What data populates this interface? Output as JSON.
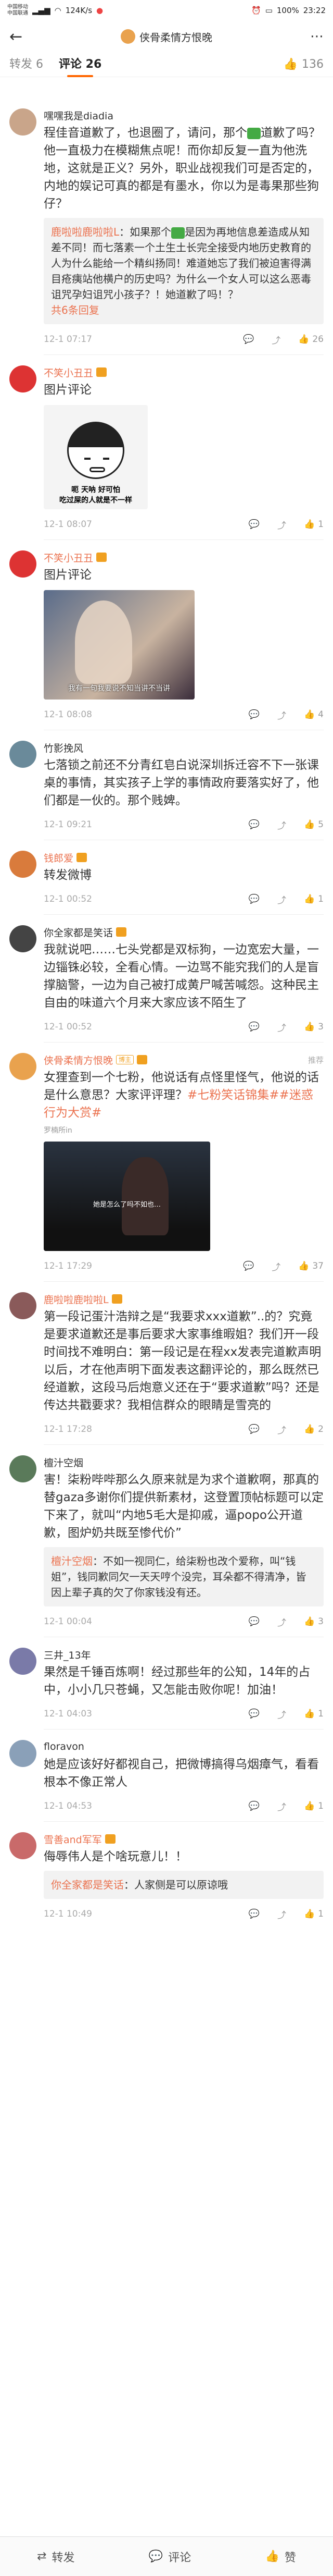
{
  "status": {
    "carrier1": "中国移动",
    "carrier2": "中国联通",
    "speed": "124K/s",
    "battery": "100%",
    "time": "23:22"
  },
  "header": {
    "title": "侠骨柔情方恨晚"
  },
  "tabs": {
    "repost": "转发 6",
    "comment": "评论 26",
    "like": "136"
  },
  "comments": [
    {
      "name": "嘿嘿我是diadia",
      "text": "程佳音道歉了，也退圈了，请问，那个",
      "text2": "道歉了吗？他一直极力在模糊焦点呢！而你却反复一直为他洗地，这就是正义？另外，职业战视我们可是否定的，内地的娱记可真的都是有墨水，你以为是毒果那些狗仔？",
      "reply_name": "鹿啦啦鹿啦啦L",
      "reply_text": "：如果那个",
      "reply_text2": "是因为再地信息差造成从知差不同！而七落素一个土生土长完全接受内地历史教育的人为什么能给一个精纠扬同！难道她忘了我们被迫害得满目疮痍站他横户的历史吗？为什么一个女人可以这么恶毒诅咒孕妇诅咒小孩子？！她道歉了吗！？",
      "reply_more": "共6条回复",
      "time": "12-1 07:17",
      "likes": "26"
    },
    {
      "name": "不笑小丑丑",
      "text": "图片评论",
      "meme1": "呃 天呐 好可怕",
      "meme2": "吃过屎的人就是不一样",
      "time": "12-1 08:07",
      "likes": "1"
    },
    {
      "name": "不笑小丑丑",
      "text": "图片评论",
      "caption": "我有一句我要说不知当讲不当讲",
      "time": "12-1 08:08",
      "likes": "4"
    },
    {
      "name": "竹影挽风",
      "text": "七落锁之前还不分青红皂白说深圳拆迁容不下一张课桌的事情，其实孩子上学的事情政府要落实好了，他们都是一伙的。那个贱婢。",
      "time": "12-1 09:21",
      "likes": "5"
    },
    {
      "name": "钱郎爱",
      "text": "转发微博",
      "time": "12-1 00:52",
      "likes": "1"
    },
    {
      "name": "你全家都是笑话",
      "text": "我就说吧……七头党都是双标狗，一边宽宏大量，一边锱铢必较，全看心情。一边骂不能究我们的人是盲撑脑警，一边为自己被打成黄尸喊苦喊怨。这种民主自由的味道六个月来大家应该不陌生了",
      "time": "12-1 00:52",
      "likes": "3"
    },
    {
      "name": "侠骨柔情方恨晚",
      "text": "女狸查到一个七粉，他说话有点怪里怪气，他说的话是什么意思？大家评评理？",
      "link": "#七粉笑话锦集##迷惑行为大赏#",
      "sub": "罗楠所in",
      "caption": "她是怎么了吗不如也…",
      "top_badge": "推荐",
      "time": "12-1 17:29",
      "likes": "37"
    },
    {
      "name": "鹿啦啦鹿啦啦L",
      "text": "第一段记蛋汁浩辩之是“我要求xxx道歉”..的？究竟是要求道歉还是事后要求大家事维暇姐？我们开一段时间找不难明白：第一段记是在程xx发表完道歉声明以后，才在他声明下面发表这翻评论的，那么既然已经道歉，这段马后炮意义还在于“要求道歉”吗？还是传达共戳要求？我相信群众的眼睛是雪亮的",
      "time": "12-1 17:28",
      "likes": "2"
    },
    {
      "name": "檀汁空烟",
      "text": "害！柒粉哔哔那么久原来就是为求个道歉啊，那真的替gaza多谢你们提供新素材，这登置顶帖标题可以定下来了，就叫“内地5毛大是抑戚，逼popo公开道歉，图炉奶共既至惨代价”",
      "reply_name": "檀汁空烟",
      "reply_text": "：不如一视同仁，给柒粉也改个爱称，叫“钱姐”，钱同歉同欠一天天哼个没完，耳朵都不得清净，皆因上辈子真的欠了你家钱没有还。",
      "time": "12-1 00:04",
      "likes": "3"
    },
    {
      "name": "三井_13年",
      "text": "果然是千锤百炼啊！经过那些年的公知，14年的占中，小小几只苍蝇，又怎能击败你呢！加油！",
      "time": "12-1 04:03",
      "likes": "1"
    },
    {
      "name": "floravon",
      "text": "她是应该好好都视自己，把微博搞得乌烟瘴气，看看根本不像正常人",
      "time": "12-1 04:53",
      "likes": "1"
    },
    {
      "name": "雪善and军军",
      "text": "侮辱伟人是个啥玩意儿！！",
      "reply_name": "你全家都是笑话",
      "reply_text": "：人家侧是可以原谅哦",
      "time": "12-1 10:49",
      "likes": "1"
    }
  ],
  "bottom": {
    "repost": "转发",
    "comment": "评论",
    "like": "赞"
  }
}
